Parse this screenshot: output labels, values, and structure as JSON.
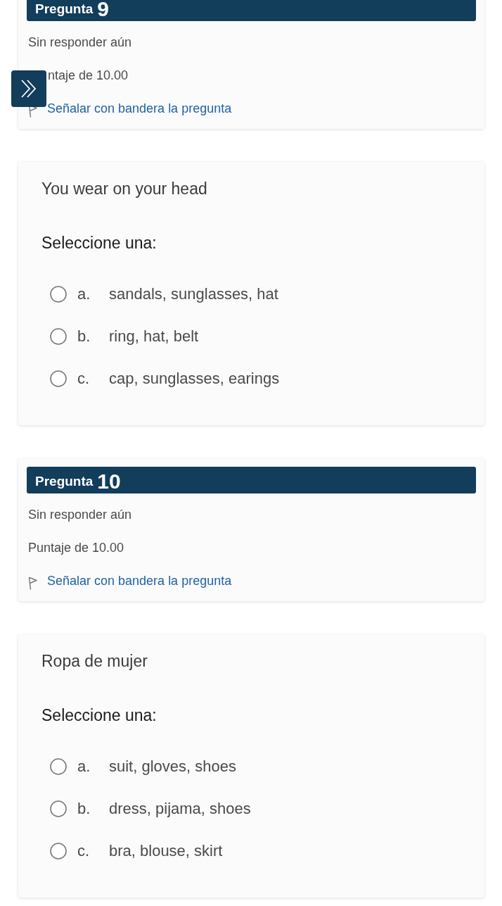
{
  "questions": [
    {
      "header_label": "Pregunta",
      "number": "9",
      "status": "Sin responder aún",
      "score": "ntaje de 10.00",
      "flag_link": "Señalar con bandera la pregunta",
      "prompt": "You wear on your head",
      "instruction": "Seleccione una:",
      "options": [
        {
          "letter": "a.",
          "text": "sandals, sunglasses, hat",
          "selected": false
        },
        {
          "letter": "b.",
          "text": "ring, hat, belt",
          "selected": false
        },
        {
          "letter": "c.",
          "text": "cap, sunglasses, earings",
          "selected": false
        }
      ]
    },
    {
      "header_label": "Pregunta",
      "number": "10",
      "status": "Sin responder aún",
      "score": "Puntaje de 10.00",
      "flag_link": "Señalar con bandera la pregunta",
      "prompt": "Ropa de mujer",
      "instruction": "Seleccione una:",
      "options": [
        {
          "letter": "a.",
          "text": "suit, gloves, shoes",
          "selected": false
        },
        {
          "letter": "b.",
          "text": "dress, pijama, shoes",
          "selected": false
        },
        {
          "letter": "c.",
          "text": "bra, blouse, skirt",
          "selected": false
        }
      ]
    }
  ]
}
